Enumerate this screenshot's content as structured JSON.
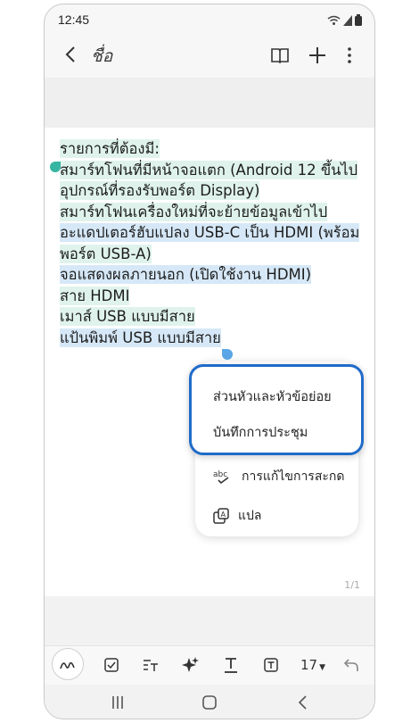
{
  "status": {
    "time": "12:45"
  },
  "header": {
    "title": "ชื่อ"
  },
  "note": {
    "lines": [
      "รายการที่ต้องมี:",
      "สมาร์ทโฟนที่มีหน้าจอแตก (Android 12 ขึ้นไป",
      "อุปกรณ์ที่รองรับพอร์ต Display)",
      "สมาร์ทโฟนเครื่องใหม่ที่จะย้ายข้อมูลเข้าไป",
      "อะแดปเตอร์ฮับแปลง USB-C เป็น HDMI (พร้อม",
      "พอร์ต USB-A)",
      "จอแสดงผลภายนอก (เปิดใช้งาน HDMI)",
      "สาย HDMI",
      "เมาส์ USB แบบมีสาย",
      "แป้นพิมพ์ USB แบบมีสาย"
    ],
    "page_indicator": "1/1"
  },
  "popup": {
    "items": [
      "ส่วนหัวและหัวข้อย่อย",
      "บันทึกการประชุม"
    ]
  },
  "menu": {
    "items": [
      {
        "label": "การแก้ไขการสะกด",
        "icon": "spell-check-icon"
      },
      {
        "label": "แปล",
        "icon": "translate-icon"
      }
    ]
  },
  "toolbar": {
    "font_size": "17"
  },
  "colors": {
    "selection": "#dff3ec",
    "accent": "#1f6bc9",
    "handle": "#35b5a2"
  }
}
